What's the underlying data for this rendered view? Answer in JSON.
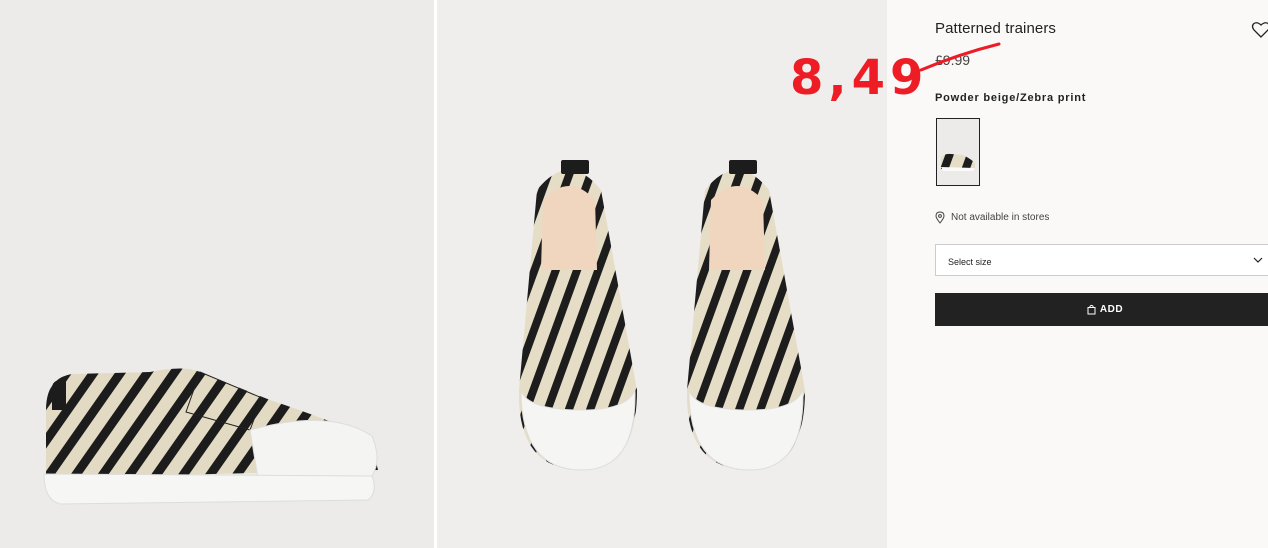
{
  "product": {
    "title": "Patterned trainers",
    "old_price": "£9.99",
    "sale_price": "8,49",
    "color_name": "Powder beige/Zebra print",
    "store_availability": "Not available in stores",
    "select_size_label": "Select size",
    "add_label": "ADD"
  },
  "icons": {
    "favorite": "heart-icon",
    "location": "map-pin-icon",
    "dropdown": "chevron-down-icon",
    "bag": "shopping-bag-icon"
  },
  "colors": {
    "annotation_red": "#ee1c24",
    "button_dark": "#222222"
  }
}
